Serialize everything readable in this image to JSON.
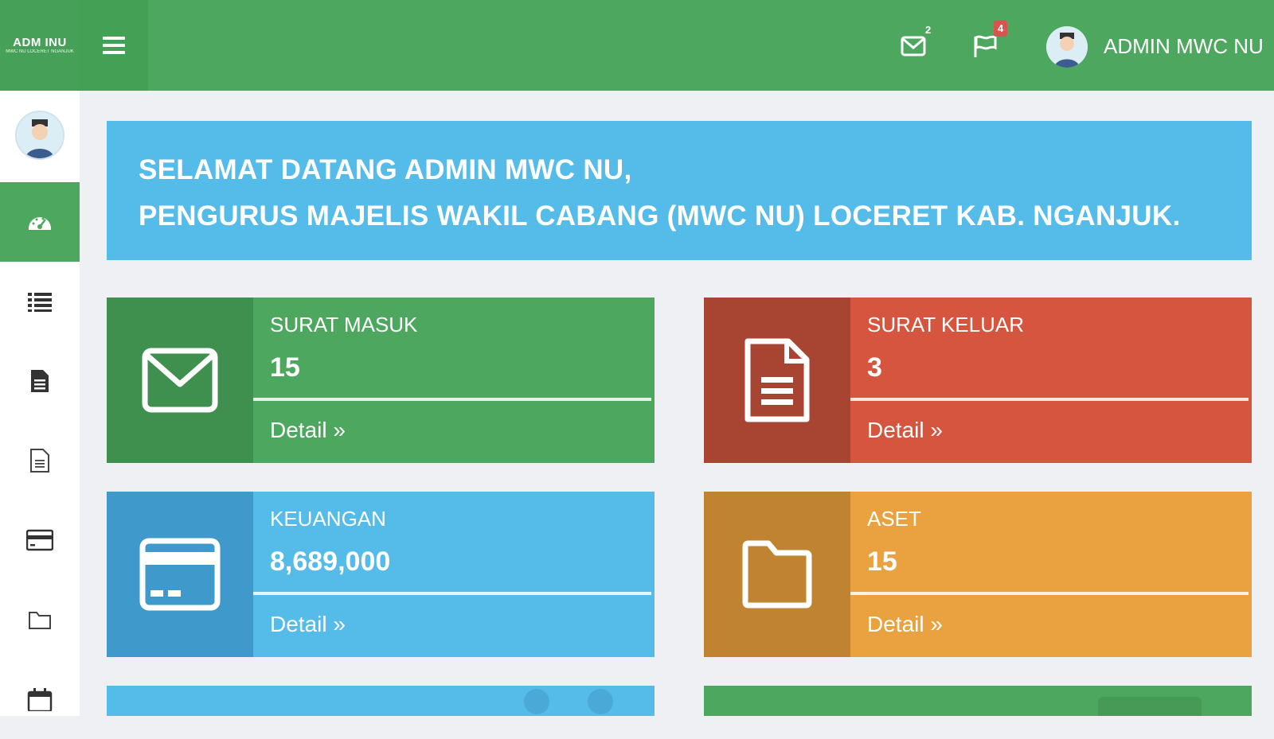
{
  "header": {
    "brand_line1": "ADM INU",
    "brand_line2": "MWC NU LOCERET NGANJUK",
    "mail_badge": "2",
    "flag_badge": "4",
    "user_name": "ADMIN MWC NU"
  },
  "sidebar": {
    "items": [
      {
        "icon": "dashboard-icon",
        "active": true
      },
      {
        "icon": "list-icon"
      },
      {
        "icon": "document-filled-icon"
      },
      {
        "icon": "document-outline-icon"
      },
      {
        "icon": "credit-card-icon"
      },
      {
        "icon": "folder-icon"
      },
      {
        "icon": "calendar-icon"
      }
    ]
  },
  "welcome": {
    "line1": "SELAMAT DATANG ADMIN MWC NU,",
    "line2": "PENGURUS MAJELIS WAKIL CABANG (MWC NU) LOCERET KAB. NGANJUK."
  },
  "cards": {
    "surat_masuk": {
      "title": "SURAT MASUK",
      "value": "15",
      "detail": "Detail »",
      "icon": "envelope-icon"
    },
    "surat_keluar": {
      "title": "SURAT KELUAR",
      "value": "3",
      "detail": "Detail »",
      "icon": "document-icon"
    },
    "keuangan": {
      "title": "KEUANGAN",
      "value": "8,689,000",
      "detail": "Detail »",
      "icon": "credit-card-icon"
    },
    "aset": {
      "title": "ASET",
      "value": "15",
      "detail": "Detail »",
      "icon": "folder-icon"
    }
  },
  "colors": {
    "green": "#4ea75f",
    "red": "#d6553f",
    "blue": "#55bbe9",
    "orange": "#e9a23f",
    "background": "#eef0f3"
  }
}
